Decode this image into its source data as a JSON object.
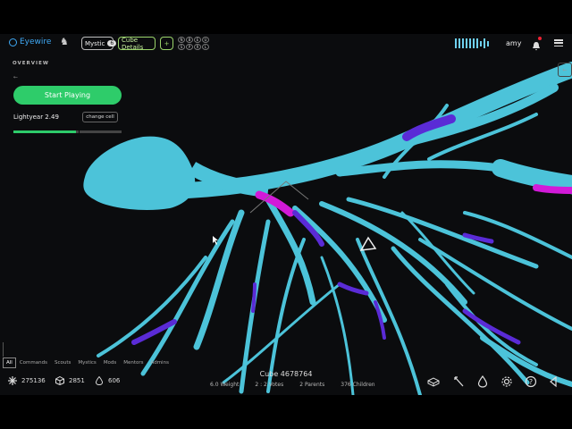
{
  "app": {
    "logo_text": "Eyewire"
  },
  "header": {
    "rank_label": "Mystic",
    "rank_count": "6",
    "cube_details_label": "Cube Details",
    "plus_label": "+",
    "badges": [
      "N",
      "B",
      "E",
      "U",
      "S",
      "P",
      "R",
      "L"
    ],
    "username": "amy"
  },
  "overview": {
    "title": "OVERVIEW",
    "back": "←",
    "start_label": "Start Playing",
    "cell_name": "Lightyear 2.49",
    "change_cell_label": "change cell",
    "progress": 0.58
  },
  "side_toggle": "←",
  "chat": {
    "tabs": [
      "All",
      "Commands",
      "Scouts",
      "Mystics",
      "Mods",
      "Mentors",
      "Admins"
    ],
    "active": "All"
  },
  "cube": {
    "id_label": "Cube 4678764",
    "weight": "6.0 Weight",
    "votes": "2 : 2 Votes",
    "parents": "2 Parents",
    "children": "376 Children"
  },
  "stats": {
    "points": "275136",
    "cubes": "2851",
    "trailblazes": "606"
  },
  "colors": {
    "accent_green": "#2ecc6a",
    "neuron_cyan": "#4cc3d9",
    "segment_purple": "#5a2bd6",
    "segment_magenta": "#d21ad8",
    "brand_blue": "#3fa9f5"
  },
  "icons": [
    "eyewire-logo-icon",
    "bell-icon",
    "menu-icon",
    "points-icon",
    "cube-icon",
    "trailblaze-icon",
    "hover-tool-icon",
    "wand-tool-icon",
    "drop-tool-icon",
    "gear-icon",
    "help-icon",
    "back-icon"
  ]
}
